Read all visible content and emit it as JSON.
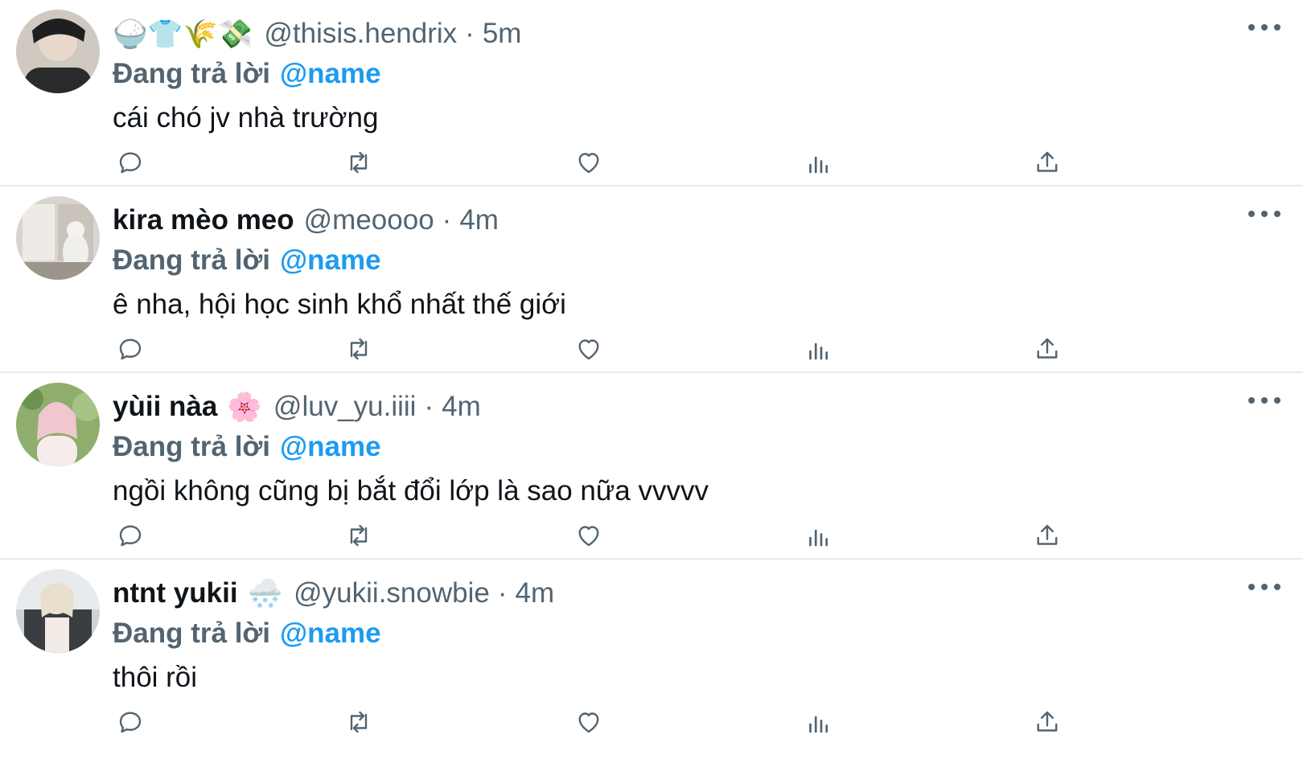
{
  "colors": {
    "link": "#1d9bf0",
    "muted": "#536471",
    "text": "#0f1419",
    "divider": "#e6ebef"
  },
  "tweets": [
    {
      "display_name": "",
      "name_emojis": [
        "🍚",
        "👕",
        "🌾",
        "💸"
      ],
      "handle": "@thisis.hendrix",
      "separator": "·",
      "time": "5m",
      "replying_prefix": "Đang trả lời",
      "replying_to": "@name",
      "text": "cái chó jv nhà trường"
    },
    {
      "display_name": "kira mèo meo",
      "name_emojis": [],
      "handle": "@meoooo",
      "separator": "·",
      "time": "4m",
      "replying_prefix": "Đang trả lời",
      "replying_to": "@name",
      "text": "ê nha, hội học sinh khổ nhất thế giới"
    },
    {
      "display_name": "yùii nàa",
      "name_emojis": [
        "🌸"
      ],
      "handle": "@luv_yu.iiii",
      "separator": "·",
      "time": "4m",
      "replying_prefix": "Đang trả lời",
      "replying_to": "@name",
      "text": "ngồi không cũng bị bắt đổi lớp là sao nữa vvvvv"
    },
    {
      "display_name": "ntnt yukii",
      "name_emojis": [
        "🌨️"
      ],
      "handle": "@yukii.snowbie",
      "separator": "·",
      "time": "4m",
      "replying_prefix": "Đang trả lời",
      "replying_to": "@name",
      "text": "thôi rồi"
    }
  ],
  "icons": {
    "reply": "reply-icon",
    "retweet": "retweet-icon",
    "like": "like-icon",
    "views": "views-icon",
    "share": "share-icon",
    "more": "more-icon"
  }
}
